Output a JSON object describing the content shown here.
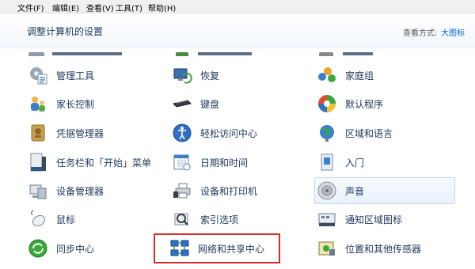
{
  "menubar": {
    "file": "文件(F)",
    "edit": "编辑(E)",
    "view": "查看(V)",
    "tools": "工具(T)",
    "help": "帮助(H)"
  },
  "header": {
    "title": "调整计算机的设置",
    "view_by_label": "查看方式:",
    "view_by_value": "大图标"
  },
  "columns": [
    {
      "items": [
        {
          "label": "管理工具",
          "icon": "admin-tools-icon"
        },
        {
          "label": "家长控制",
          "icon": "parental-controls-icon"
        },
        {
          "label": "凭据管理器",
          "icon": "credential-manager-icon"
        },
        {
          "label": "任务栏和「开始」菜单",
          "icon": "taskbar-icon"
        },
        {
          "label": "设备管理器",
          "icon": "device-manager-icon"
        },
        {
          "label": "鼠标",
          "icon": "mouse-icon"
        },
        {
          "label": "同步中心",
          "icon": "sync-center-icon"
        }
      ]
    },
    {
      "items": [
        {
          "label": "恢复",
          "icon": "recovery-icon"
        },
        {
          "label": "键盘",
          "icon": "keyboard-icon"
        },
        {
          "label": "轻松访问中心",
          "icon": "ease-of-access-icon"
        },
        {
          "label": "日期和时间",
          "icon": "date-time-icon"
        },
        {
          "label": "设备和打印机",
          "icon": "devices-printers-icon"
        },
        {
          "label": "索引选项",
          "icon": "indexing-icon"
        },
        {
          "label": "网络和共享中心",
          "icon": "network-sharing-icon"
        }
      ]
    },
    {
      "items": [
        {
          "label": "家庭组",
          "icon": "homegroup-icon"
        },
        {
          "label": "默认程序",
          "icon": "default-programs-icon"
        },
        {
          "label": "区域和语言",
          "icon": "region-language-icon"
        },
        {
          "label": "入门",
          "icon": "getting-started-icon"
        },
        {
          "label": "声音",
          "icon": "sound-icon"
        },
        {
          "label": "通知区域图标",
          "icon": "notification-icons-icon"
        },
        {
          "label": "位置和其他传感器",
          "icon": "location-sensors-icon"
        }
      ]
    }
  ],
  "colors": {
    "highlight_box": "#d52b2b",
    "label_text": "#1e395b",
    "link": "#0066cc"
  }
}
